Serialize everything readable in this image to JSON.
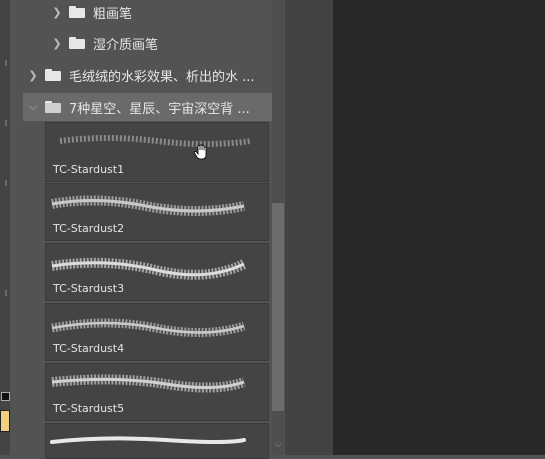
{
  "colors": {
    "panel_bg": "#535353",
    "selected_row": "#6a6a6a",
    "thumbnail_bg": "#444444",
    "canvas_bg": "#282828"
  },
  "folders": [
    {
      "label": "粗画笔",
      "expanded": false
    },
    {
      "label": "湿介质画笔",
      "expanded": false
    },
    {
      "label": "毛绒绒的水彩效果、析出的水 ...",
      "expanded": false
    },
    {
      "label": "7种星空、星辰、宇宙深空背 ...",
      "expanded": true,
      "selected": true
    }
  ],
  "brushes": [
    {
      "name": "TC-Stardust1"
    },
    {
      "name": "TC-Stardust2"
    },
    {
      "name": "TC-Stardust3"
    },
    {
      "name": "TC-Stardust4"
    },
    {
      "name": "TC-Stardust5"
    },
    {
      "name": ""
    }
  ],
  "icons": {
    "chevron_collapsed": "chevron-right-icon",
    "chevron_expanded": "chevron-down-icon",
    "folder": "folder-icon",
    "cursor": "hand-cursor-icon"
  }
}
